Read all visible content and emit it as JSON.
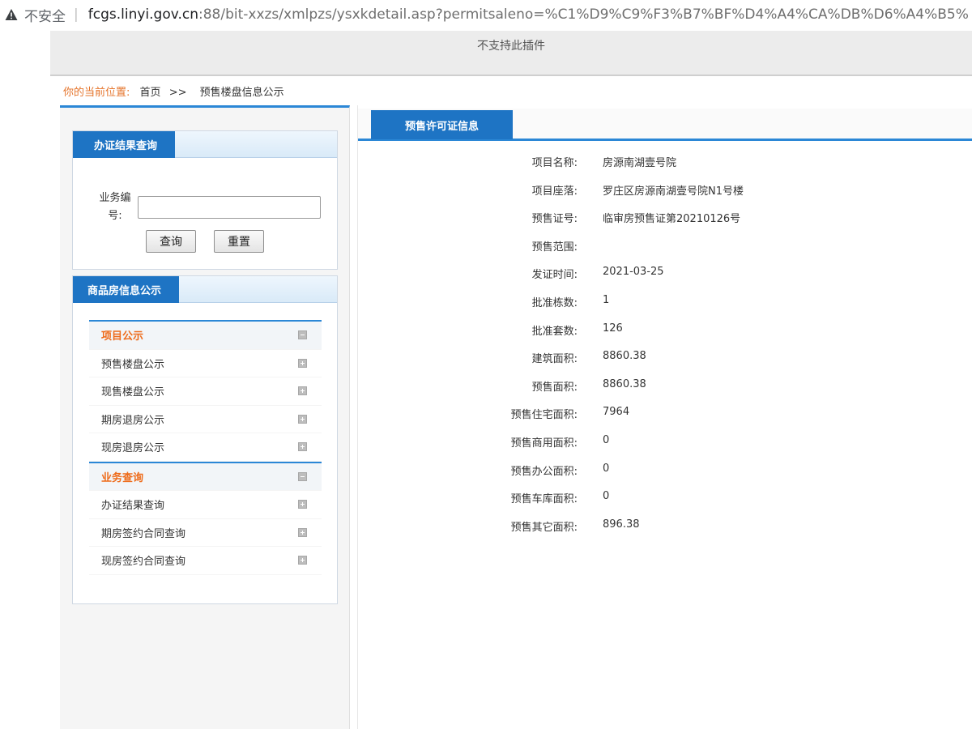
{
  "browser": {
    "insecure_label": "不安全",
    "separator": "|",
    "url_host": "fcgs.linyi.gov.cn",
    "url_path": ":88/bit-xxzs/xmlpzs/ysxkdetail.asp?permitsaleno=%C1%D9%C9%F3%B7%BF%D4%A4%CA%DB%D6%A4%B5%"
  },
  "plugin_notice": "不支持此插件",
  "breadcrumb": {
    "location_label": "你的当前位置:",
    "home": "首页",
    "arrow": ">>",
    "current": "预售楼盘信息公示"
  },
  "query_panel": {
    "title": "办证结果查询",
    "field_label": "业务编号:",
    "field_value": "",
    "query_button": "查询",
    "reset_button": "重置"
  },
  "nav_panel": {
    "title": "商品房信息公示",
    "groups": [
      {
        "label": "项目公示",
        "items": [
          "预售楼盘公示",
          "现售楼盘公示",
          "期房退房公示",
          "现房退房公示"
        ]
      },
      {
        "label": "业务查询",
        "items": [
          "办证结果查询",
          "期房签约合同查询",
          "现房签约合同查询"
        ]
      }
    ]
  },
  "main": {
    "tab_title": "预售许可证信息",
    "fields": [
      {
        "label": "项目名称:",
        "value": "房源南湖壹号院"
      },
      {
        "label": "项目座落:",
        "value": "罗庄区房源南湖壹号院N1号楼"
      },
      {
        "label": "预售证号:",
        "value": "临审房预售证第20210126号"
      },
      {
        "label": "预售范围:",
        "value": ""
      },
      {
        "label": "发证时间:",
        "value": "2021-03-25"
      },
      {
        "label": "批准栋数:",
        "value": "1"
      },
      {
        "label": "批准套数:",
        "value": "126"
      },
      {
        "label": "建筑面积:",
        "value": "8860.38"
      },
      {
        "label": "预售面积:",
        "value": "8860.38"
      },
      {
        "label": "预售住宅面积:",
        "value": "7964"
      },
      {
        "label": "预售商用面积:",
        "value": "0"
      },
      {
        "label": "预售办公面积:",
        "value": "0"
      },
      {
        "label": "预售车库面积:",
        "value": "0"
      },
      {
        "label": "预售其它面积:",
        "value": "896.38"
      }
    ]
  }
}
